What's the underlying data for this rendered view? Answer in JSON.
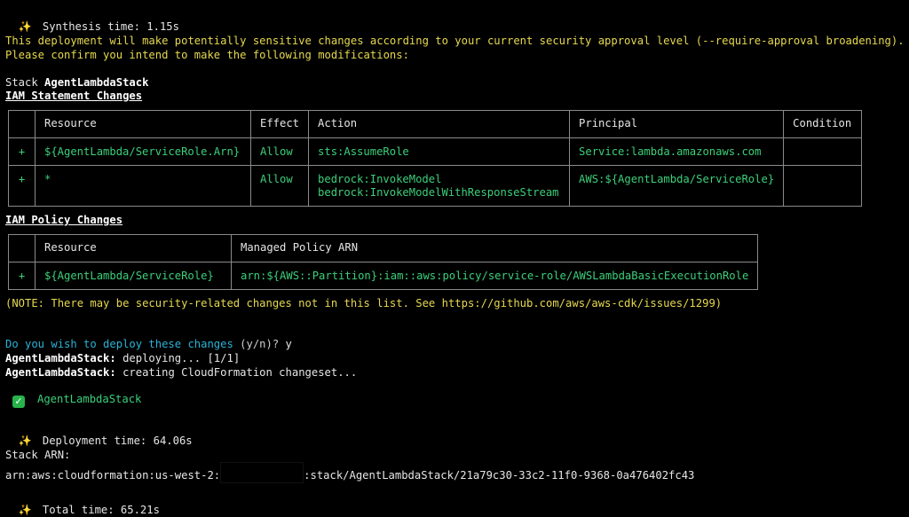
{
  "synthesis_time": "Synthesis time: 1.15s",
  "warning_line1": "This deployment will make potentially sensitive changes according to your current security approval level (--require-approval broadening).",
  "warning_line2": "Please confirm you intend to make the following modifications:",
  "stack_prefix": "Stack ",
  "stack_name": "AgentLambdaStack",
  "iam_statement_heading": "IAM Statement Changes",
  "statement_table": {
    "headers": [
      "",
      "Resource",
      "Effect",
      "Action",
      "Principal",
      "Condition"
    ],
    "rows": [
      {
        "sign": "+",
        "resource": "${AgentLambda/ServiceRole.Arn}",
        "effect": "Allow",
        "action": "sts:AssumeRole",
        "principal": "Service:lambda.amazonaws.com",
        "condition": ""
      },
      {
        "sign": "+",
        "resource": "*",
        "effect": "Allow",
        "action": "bedrock:InvokeModel\nbedrock:InvokeModelWithResponseStream",
        "principal": "AWS:${AgentLambda/ServiceRole}",
        "condition": ""
      }
    ]
  },
  "iam_policy_heading": "IAM Policy Changes",
  "policy_table": {
    "headers": [
      "",
      "Resource",
      "Managed Policy ARN"
    ],
    "rows": [
      {
        "sign": "+",
        "resource": "${AgentLambda/ServiceRole}",
        "arn": "arn:${AWS::Partition}:iam::aws:policy/service-role/AWSLambdaBasicExecutionRole"
      }
    ]
  },
  "note": "(NOTE: There may be security-related changes not in this list. See https://github.com/aws/aws-cdk/issues/1299)",
  "prompt_question": "Do you wish to deploy these changes",
  "prompt_options": " (y/n)? ",
  "prompt_answer": "y",
  "deploying_label": "AgentLambdaStack:",
  "deploying_text": " deploying... [1/1]",
  "changeset_label": "AgentLambdaStack:",
  "changeset_text": " creating CloudFormation changeset...",
  "success_stack": "AgentLambdaStack",
  "deployment_time": "Deployment time: 64.06s",
  "stack_arn_label": "Stack ARN:",
  "stack_arn_prefix": "arn:aws:cloudformation:us-west-2:",
  "stack_arn_suffix": ":stack/AgentLambdaStack/21a79c30-33c2-11f0-9368-0a476402fc43",
  "total_time": "Total time: 65.21s",
  "sparkle_glyph": "✨",
  "check_glyph": "✓",
  "colors": {
    "warning": "#e6d84f",
    "added": "#3ccf7a",
    "prompt": "#2bb3d6",
    "success_badge": "#27b34a"
  }
}
